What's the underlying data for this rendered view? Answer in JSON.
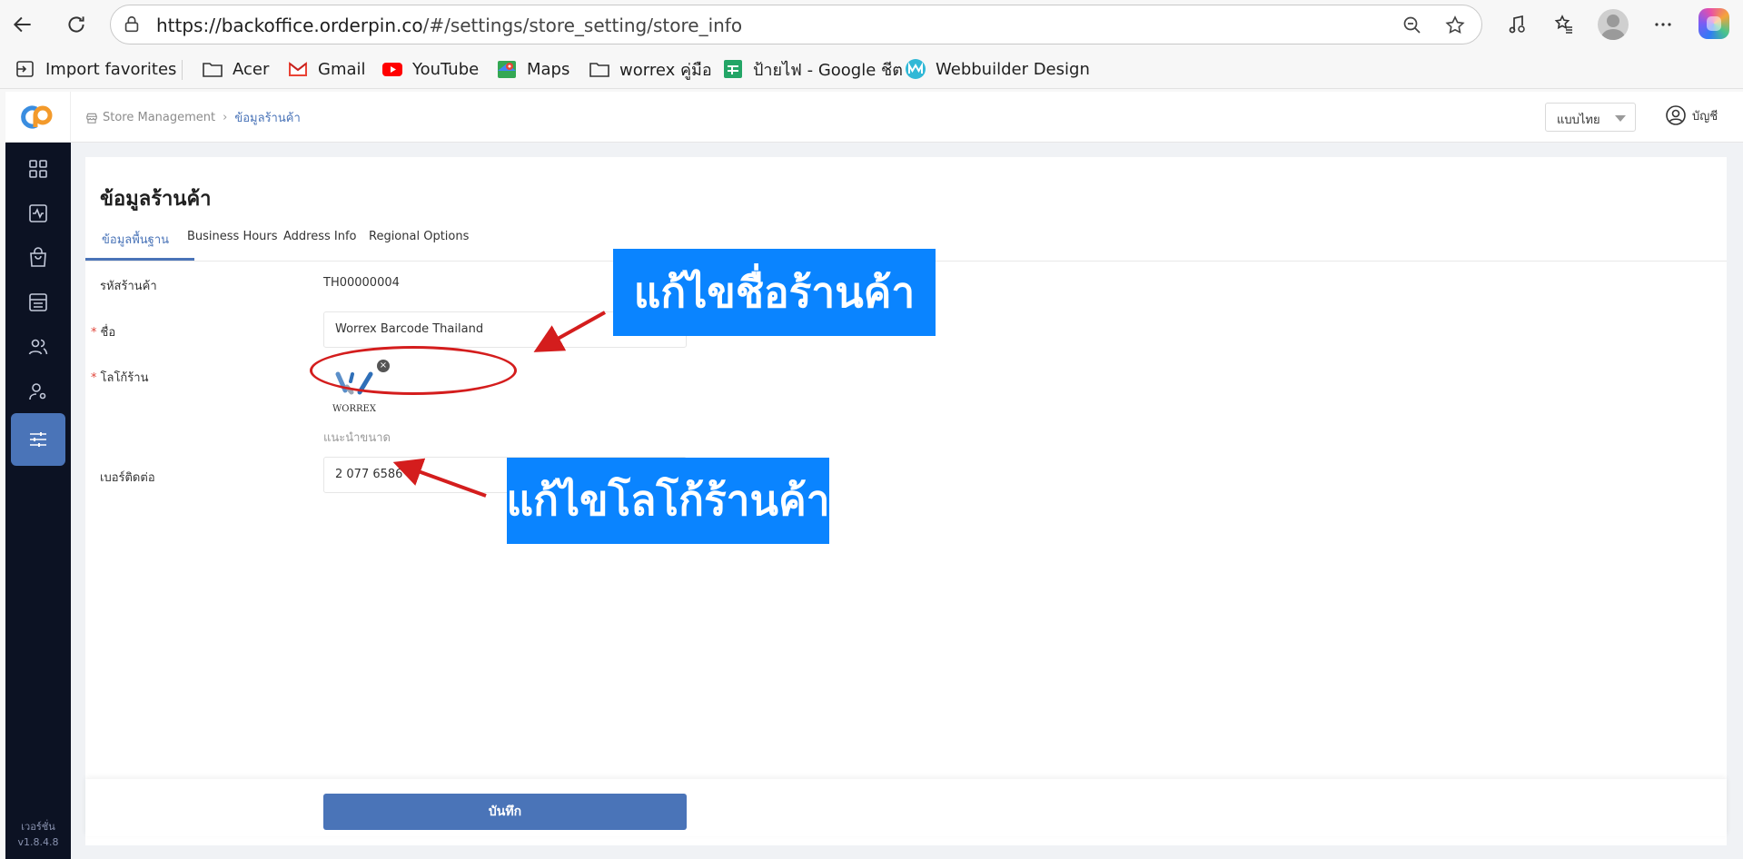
{
  "browser": {
    "url_host": "https://backoffice.orderpin.co",
    "url_path": "/#/settings/store_setting/store_info",
    "bookmarks": [
      {
        "label": "Import favorites",
        "icon": "import-icon"
      },
      {
        "label": "Acer",
        "icon": "folder-icon"
      },
      {
        "label": "Gmail",
        "icon": "gmail-icon"
      },
      {
        "label": "YouTube",
        "icon": "youtube-icon"
      },
      {
        "label": "Maps",
        "icon": "maps-icon"
      },
      {
        "label": "worrex คู่มือ",
        "icon": "folder-icon"
      },
      {
        "label": "ป้ายไฟ - Google ชีต",
        "icon": "sheets-icon"
      },
      {
        "label": "Webbuilder Design",
        "icon": "webbuilder-icon"
      }
    ]
  },
  "header": {
    "breadcrumb_root": "Store Management",
    "breadcrumb_current": "ข้อมูลร้านค้า",
    "language": "แบบไทย",
    "account_label": "บัญชี"
  },
  "sidebar": {
    "items": [
      {
        "icon": "dashboard-grid-icon"
      },
      {
        "icon": "activity-chart-icon"
      },
      {
        "icon": "shopping-bag-icon"
      },
      {
        "icon": "storefront-icon"
      },
      {
        "icon": "users-group-icon"
      },
      {
        "icon": "user-settings-icon"
      },
      {
        "icon": "sliders-settings-icon",
        "active": true
      }
    ],
    "version_label": "เวอร์ชั่น",
    "version_number": "v1.8.4.8"
  },
  "page": {
    "title": "ข้อมูลร้านค้า",
    "tabs": [
      "ข้อมูลพื้นฐาน",
      "Business Hours",
      "Address Info",
      "Regional Options"
    ],
    "active_tab": 0
  },
  "form": {
    "store_code_label": "รหัสร้านค้า",
    "store_code_value": "TH00000004",
    "name_label": "ชื่อ",
    "name_value": "Worrex Barcode Thailand",
    "logo_label": "โลโก้ร้าน",
    "logo_text": "WORREX",
    "logo_hint": "แนะนำขนาด",
    "phone_label": "เบอร์ติดต่อ",
    "phone_value": "2 077 6586",
    "save_label": "บันทึก"
  },
  "annotations": {
    "edit_name": "แก้ไขชื่อร้านค้า",
    "edit_logo": "แก้ไขโลโก้ร้านค้า"
  },
  "colors": {
    "accent": "#4a74b8",
    "sidebar_bg": "#0c1223",
    "callout_bg": "#0a84ff",
    "annotation_red": "#d41d1d",
    "required": "#e0453a"
  }
}
